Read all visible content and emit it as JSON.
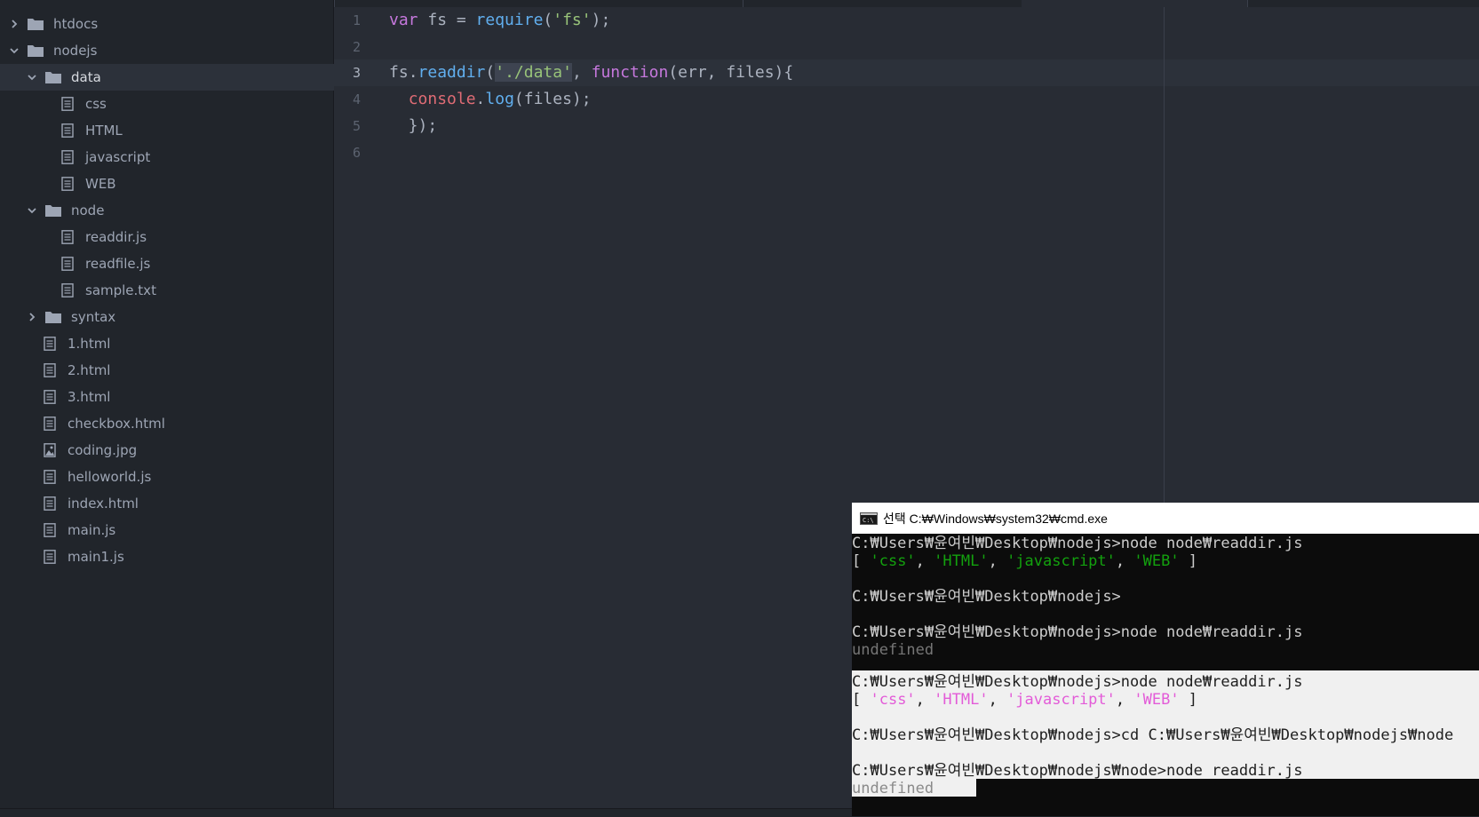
{
  "sidebar": {
    "items": [
      {
        "label": "htdocs",
        "type": "folder",
        "expanded": false,
        "depth": 0
      },
      {
        "label": "nodejs",
        "type": "folder",
        "expanded": true,
        "depth": 0
      },
      {
        "label": "data",
        "type": "folder",
        "expanded": true,
        "depth": 1,
        "selected": true
      },
      {
        "label": "css",
        "type": "file",
        "depth": 2
      },
      {
        "label": "HTML",
        "type": "file",
        "depth": 2
      },
      {
        "label": "javascript",
        "type": "file",
        "depth": 2
      },
      {
        "label": "WEB",
        "type": "file",
        "depth": 2
      },
      {
        "label": "node",
        "type": "folder",
        "expanded": true,
        "depth": 1
      },
      {
        "label": "readdir.js",
        "type": "file",
        "depth": 2
      },
      {
        "label": "readfile.js",
        "type": "file",
        "depth": 2
      },
      {
        "label": "sample.txt",
        "type": "file",
        "depth": 2
      },
      {
        "label": "syntax",
        "type": "folder",
        "expanded": false,
        "depth": 1
      },
      {
        "label": "1.html",
        "type": "file",
        "depth": 1
      },
      {
        "label": "2.html",
        "type": "file",
        "depth": 1
      },
      {
        "label": "3.html",
        "type": "file",
        "depth": 1
      },
      {
        "label": "checkbox.html",
        "type": "file",
        "depth": 1
      },
      {
        "label": "coding.jpg",
        "type": "image",
        "depth": 1
      },
      {
        "label": "helloworld.js",
        "type": "file",
        "depth": 1
      },
      {
        "label": "index.html",
        "type": "file",
        "depth": 1
      },
      {
        "label": "main.js",
        "type": "file",
        "depth": 1
      },
      {
        "label": "main1.js",
        "type": "file",
        "depth": 1
      }
    ]
  },
  "editor": {
    "line_numbers": [
      "1",
      "2",
      "3",
      "4",
      "5",
      "6"
    ],
    "current_line": "3",
    "code": {
      "l1": {
        "var": "var",
        "sp1": " fs = ",
        "require": "require",
        "open": "(",
        "str": "'fs'",
        "close": ");"
      },
      "l3": {
        "obj": "fs",
        "dot": ".",
        "method": "readdir",
        "open": "(",
        "str": "'./data'",
        "comma": ", ",
        "func": "function",
        "args": "(err, files){"
      },
      "l4": {
        "indent": "  ",
        "obj": "console",
        "dot": ".",
        "method": "log",
        "args": "(files);"
      },
      "l5": {
        "text": "  });"
      }
    }
  },
  "cmd": {
    "title": "선택 C:₩Windows₩system32₩cmd.exe",
    "lines": {
      "l1": "C:₩Users₩윤여빈₩Desktop₩nodejs>node node₩readdir.js",
      "l2": {
        "open": "[ ",
        "a": "'css'",
        "s1": ", ",
        "b": "'HTML'",
        "s2": ", ",
        "c": "'javascript'",
        "s3": ", ",
        "d": "'WEB'",
        "close": " ]"
      },
      "l3": "C:₩Users₩윤여빈₩Desktop₩nodejs>",
      "l4": "C:₩Users₩윤여빈₩Desktop₩nodejs>node node₩readdir.js",
      "l5": "undefined",
      "l6": "C:₩Users₩윤여빈₩Desktop₩nodejs>node node₩readdir.js",
      "l7": {
        "open": "[ ",
        "a": "'css'",
        "s1": ", ",
        "b": "'HTML'",
        "s2": ", ",
        "c": "'javascript'",
        "s3": ", ",
        "d": "'WEB'",
        "close": " ]"
      },
      "l8": "C:₩Users₩윤여빈₩Desktop₩nodejs>cd C:₩Users₩윤여빈₩Desktop₩nodejs₩node",
      "l9": "C:₩Users₩윤여빈₩Desktop₩nodejs₩node>node readdir.js",
      "l10": "undefined"
    }
  },
  "colors": {
    "sidebar_bg": "#21252b",
    "editor_bg": "#282c34",
    "keyword": "#c678dd",
    "function": "#61afef",
    "string": "#98c379",
    "object": "#e06c75",
    "terminal_green": "#13a10e",
    "terminal_magenta": "#e35bd8"
  }
}
